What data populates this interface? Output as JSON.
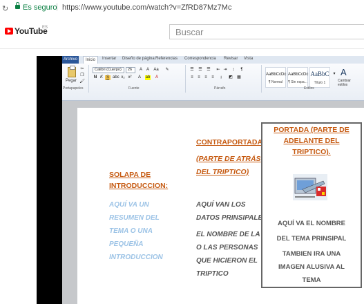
{
  "browser": {
    "secure_label": "Es seguro",
    "url": "https://www.youtube.com/watch?v=ZfRD87Mz7Mc"
  },
  "youtube": {
    "logo_text": "YouTube",
    "region": "ES",
    "search_placeholder": "Buscar"
  },
  "word": {
    "tabs": [
      "Archivo",
      "Inicio",
      "Insertar",
      "Diseño de página",
      "Referencias",
      "Correspondencia",
      "Revisar",
      "Vista"
    ],
    "clipboard": {
      "paste_label": "Pegar",
      "group_label": "Portapapeles"
    },
    "font": {
      "name": "Calibri (Cuerpo)",
      "size": "26",
      "group_label": "Fuente"
    },
    "paragraph": {
      "group_label": "Párrafo"
    },
    "styles": {
      "items": [
        {
          "preview": "AaBbCcDc",
          "name": "¶ Normal"
        },
        {
          "preview": "AaBbCcDc",
          "name": "¶ Sin espa..."
        },
        {
          "preview": "AaBbC",
          "name": "Título 1"
        }
      ],
      "change_label": "Cambiar estilos",
      "group_label": "Estilos"
    }
  },
  "document": {
    "solapa": {
      "title": [
        "SOLAPA DE",
        "INTRODUCCION:"
      ],
      "body": [
        "AQUÍ VA UN",
        "RESUMEN DEL",
        "TEMA O UNA",
        "PEQUEÑA",
        "INTRODUCCION"
      ]
    },
    "contraportada": {
      "title": [
        "CONTRAPORTADA:",
        "(PARTE DE ATRÁS",
        "DEL TRIPTICO)"
      ],
      "body": [
        "AQUÍ VAN LOS",
        "DATOS PRINSIPALES.",
        "EL NOMBRE DE LA",
        "O LAS PERSONAS",
        "QUE HICIERON EL",
        "TRIPTICO"
      ]
    },
    "portada": {
      "title": [
        "PORTADA (PARTE DE",
        "ADELANTE DEL",
        "TRIPTICO)."
      ],
      "body": [
        "AQUÍ VA EL NOMBRE",
        "DEL TEMA PRINSIPAL",
        "TAMBIEN IRA UNA",
        "IMAGEN ALUSIVA AL",
        "TEMA"
      ]
    }
  }
}
